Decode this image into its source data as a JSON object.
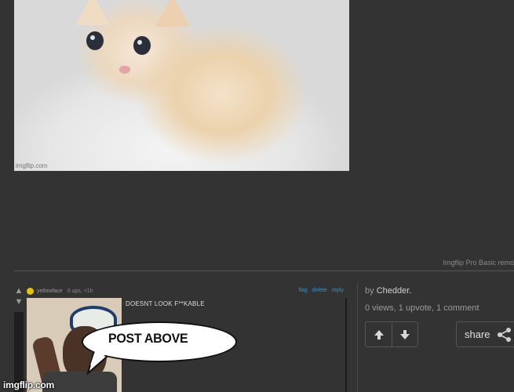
{
  "image": {
    "watermark": "imgflip.com"
  },
  "pro_note": "Imgflip Pro Basic remo",
  "comment": {
    "username": "yellowface",
    "meta": "0 ups, <1h",
    "links": [
      "flag",
      "delete",
      "reply"
    ],
    "text": "DOESNT LOOK F**KABLE",
    "bubble_text": "POST ABOVE",
    "image_watermark": "imgflip.com"
  },
  "sidebar": {
    "by_prefix": "by",
    "author": "Chedder.",
    "stats": "0 views, 1 upvote, 1 comment",
    "share_label": "share"
  },
  "icons": {
    "upvote": "up-arrow-icon",
    "downvote": "down-arrow-icon",
    "share": "share-icon",
    "user_badge": "user-badge-icon"
  },
  "colors": {
    "background": "#333333",
    "link": "#2a94d6",
    "badge": "#e6c200"
  }
}
